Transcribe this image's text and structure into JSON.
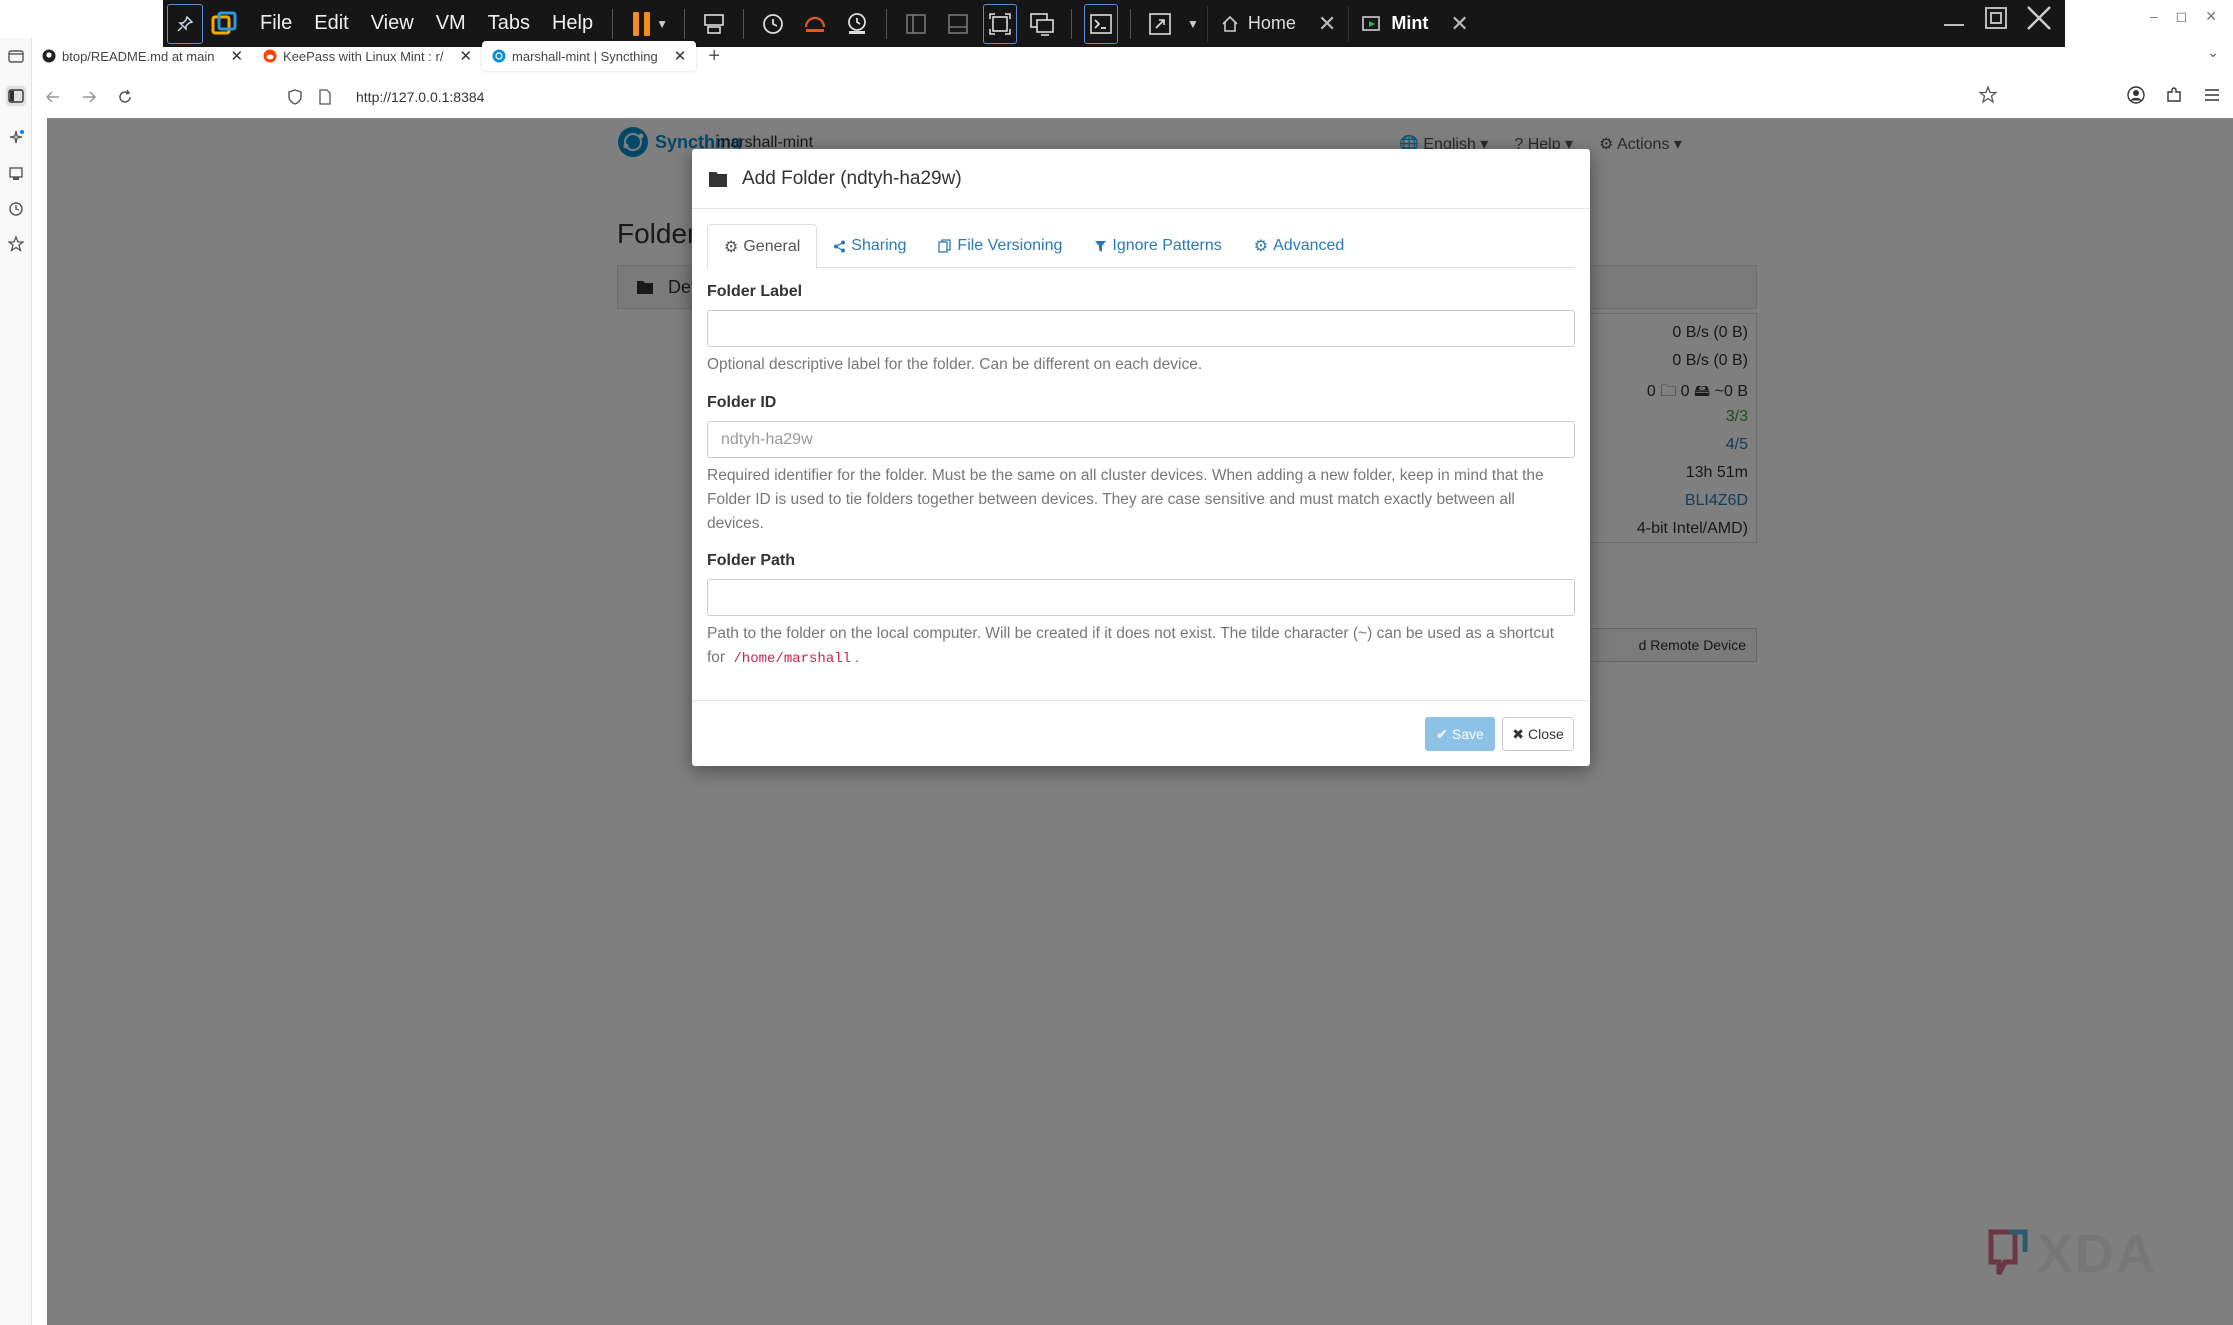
{
  "vm_toolbar": {
    "menus": [
      "File",
      "Edit",
      "View",
      "VM",
      "Tabs",
      "Help"
    ],
    "tabs": [
      {
        "label": "Home"
      },
      {
        "label": "Mint"
      }
    ]
  },
  "browser": {
    "tabs": [
      {
        "label": "btop/README.md at main"
      },
      {
        "label": "KeePass with Linux Mint : r/"
      },
      {
        "label": "marshall-mint | Syncthing"
      }
    ],
    "url": "http://127.0.0.1:8384"
  },
  "syncthing": {
    "brand": "Syncthing",
    "device_name": "marshall-mint",
    "nav": {
      "language": "English",
      "help": "Help",
      "actions": "Actions"
    },
    "folders_heading": "Folders",
    "default_folder": "Default",
    "device_stats": [
      {
        "value": "0 B/s (0 B)",
        "tone": "normal"
      },
      {
        "value": "0 B/s (0 B)",
        "tone": "normal"
      },
      {
        "value": "0  🗀 0  🖴 ~0 B",
        "tone": "normal"
      },
      {
        "value": "3/3",
        "tone": "green"
      },
      {
        "value": "4/5",
        "tone": "blue"
      },
      {
        "value": "13h 51m",
        "tone": "normal"
      },
      {
        "value": "BLI4Z6D",
        "tone": "blue"
      },
      {
        "value": "4-bit Intel/AMD)",
        "tone": "normal"
      }
    ],
    "add_remote_device": "d Remote Device"
  },
  "modal": {
    "title": "Add Folder (ndtyh-ha29w)",
    "tabs": [
      {
        "label": "General"
      },
      {
        "label": "Sharing"
      },
      {
        "label": "File Versioning"
      },
      {
        "label": "Ignore Patterns"
      },
      {
        "label": "Advanced"
      }
    ],
    "folder_label": {
      "label": "Folder Label",
      "value": "",
      "help": "Optional descriptive label for the folder. Can be different on each device."
    },
    "folder_id": {
      "label": "Folder ID",
      "value": "ndtyh-ha29w",
      "help": "Required identifier for the folder. Must be the same on all cluster devices. When adding a new folder, keep in mind that the Folder ID is used to tie folders together between devices. They are case sensitive and must match exactly between all devices."
    },
    "folder_path": {
      "label": "Folder Path",
      "value": "",
      "help_prefix": "Path to the folder on the local computer. Will be created if it does not exist. The tilde character (~) can be used as a shortcut for",
      "help_code": "/home/marshall",
      "help_suffix": "."
    },
    "save_label": "Save",
    "close_label": "Close"
  },
  "watermark": "XDA",
  "colors": {
    "syncthing_blue": "#0891d1",
    "link_blue": "#2a7ab8",
    "save_button": "#8ec1e6",
    "pause_orange": "#f28c1e"
  }
}
